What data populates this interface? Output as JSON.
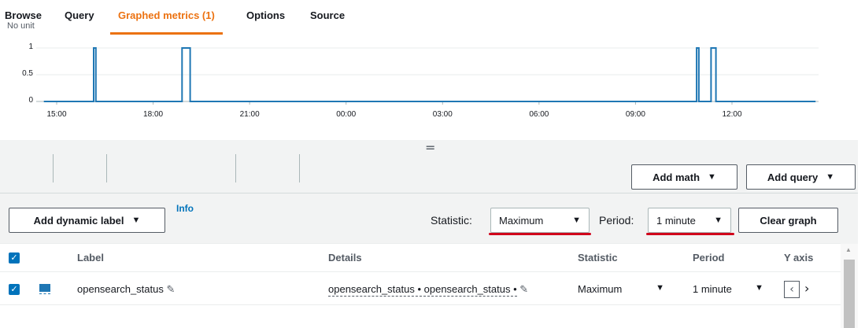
{
  "chart_data": {
    "type": "line",
    "ylabel": "No unit",
    "yticks": [
      "1",
      "0.5",
      "0"
    ],
    "ylim": [
      0,
      1
    ],
    "xticks": [
      "15:00",
      "18:00",
      "21:00",
      "00:00",
      "03:00",
      "06:00",
      "09:00",
      "12:00"
    ],
    "xlim_hours": [
      14.2,
      38.6
    ],
    "series": [
      {
        "color": "#1f77b4",
        "points": [
          [
            14.6,
            0
          ],
          [
            16.15,
            0
          ],
          [
            16.15,
            1
          ],
          [
            16.22,
            1
          ],
          [
            16.22,
            0
          ],
          [
            18.9,
            0
          ],
          [
            18.9,
            1
          ],
          [
            19.15,
            1
          ],
          [
            19.15,
            0
          ],
          [
            34.9,
            0
          ],
          [
            34.9,
            1
          ],
          [
            34.97,
            1
          ],
          [
            34.97,
            0
          ],
          [
            35.35,
            0
          ],
          [
            35.35,
            1
          ],
          [
            35.5,
            1
          ],
          [
            35.5,
            0
          ],
          [
            38.6,
            0
          ]
        ]
      }
    ]
  },
  "tabs": {
    "browse": "Browse",
    "query": "Query",
    "graphed": "Graphed metrics (1)",
    "options": "Options",
    "source": "Source"
  },
  "buttons": {
    "add_math": "Add math",
    "add_query": "Add query",
    "add_dynamic_label": "Add dynamic label",
    "clear_graph": "Clear graph"
  },
  "toolbar": {
    "info": "Info",
    "statistic_label": "Statistic:",
    "statistic_value": "Maximum",
    "period_label": "Period:",
    "period_value": "1 minute",
    "highlight_color": "#d0021b"
  },
  "table": {
    "headers": {
      "label": "Label",
      "details": "Details",
      "statistic": "Statistic",
      "period": "Period",
      "yaxis": "Y axis"
    },
    "rows": [
      {
        "label": "opensearch_status",
        "details": "opensearch_status • opensearch_status •",
        "statistic": "Maximum",
        "period": "1 minute"
      }
    ]
  },
  "icons": {
    "caret": "▼",
    "check": "✓",
    "pencil": "✎",
    "grip": "=",
    "chev_left": "‹",
    "chev_right": "›",
    "scroll_up": "▲"
  }
}
